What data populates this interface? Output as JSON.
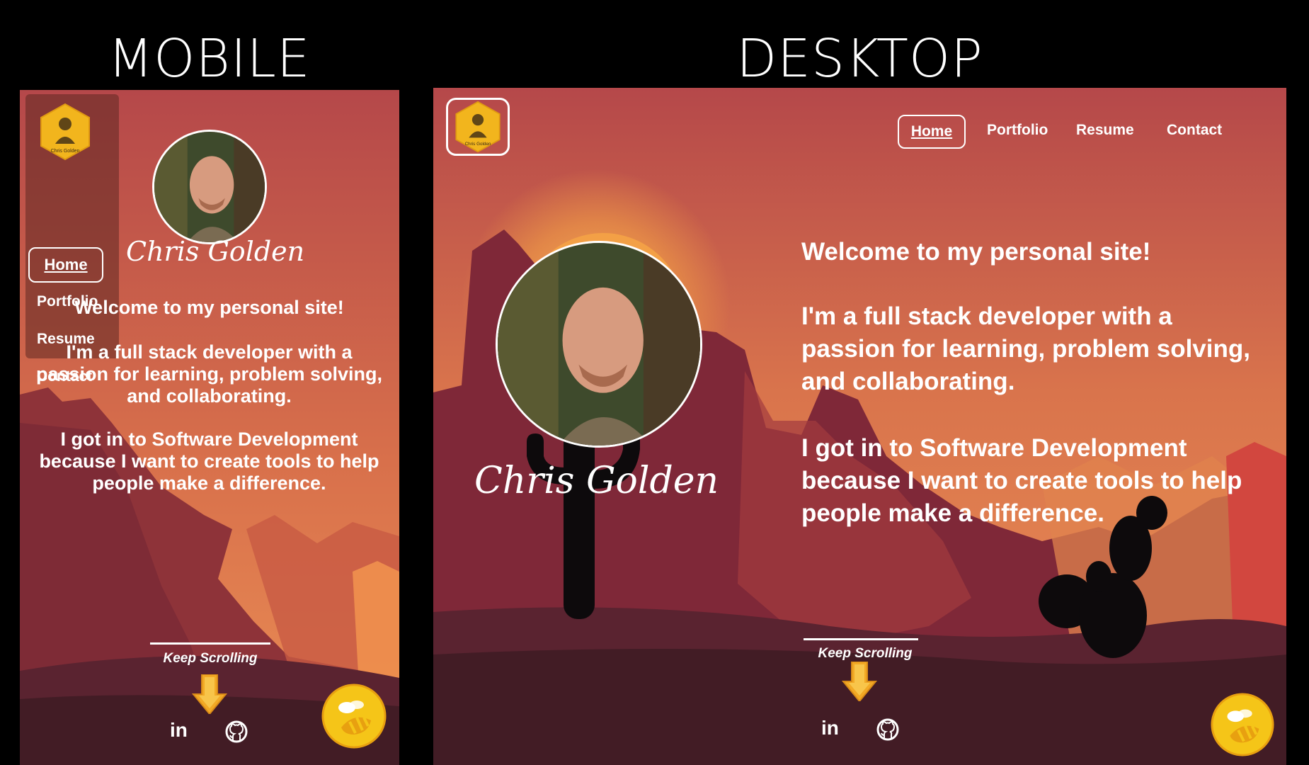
{
  "headings": {
    "mobile": "MOBILE",
    "desktop": "DESKTOP"
  },
  "logo": {
    "text": "Chris Golden"
  },
  "nav": {
    "items": [
      {
        "label": "Home",
        "active": true
      },
      {
        "label": "Portfolio",
        "active": false
      },
      {
        "label": "Resume",
        "active": false
      },
      {
        "label": "Contact",
        "active": false
      }
    ]
  },
  "profile": {
    "name": "Chris Golden"
  },
  "intro": {
    "welcome": "Welcome to my personal site!",
    "p1": "I'm a full stack developer with a passion for learning, problem solving, and collaborating.",
    "p2": "I got in to Software Development because I want to create tools to help people make a difference."
  },
  "scroll": {
    "label": "Keep Scrolling"
  },
  "social": {
    "linkedin": "in"
  },
  "colors": {
    "sky_top": "#b5484a",
    "sky_bottom": "#e8864f",
    "mesa": "#7f2838",
    "ground": "#421c25",
    "sun": "#f3a046",
    "cactus": "#0d0a0c",
    "hex_yellow": "#f2b51d"
  },
  "icons": [
    "logo-hex-icon",
    "arrow-down-icon",
    "linkedin-icon",
    "github-icon",
    "bee-icon"
  ]
}
